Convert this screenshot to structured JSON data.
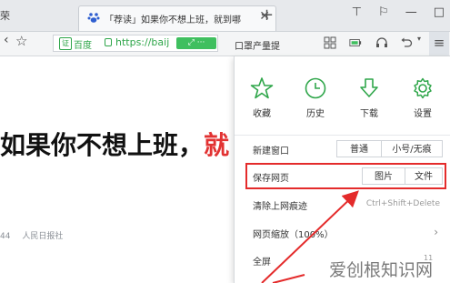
{
  "tabbar": {
    "prev_tab_label": "荣",
    "active_tab_title": "「荐读」如果你不想上班，就到哪",
    "close_glyph": "✕",
    "new_tab_glyph": "+"
  },
  "window_buttons": [
    "⊤",
    "⚐",
    "—",
    "□"
  ],
  "toolbar": {
    "back_glyph": "‹",
    "star_glyph": "☆",
    "badge_label": "证",
    "url_label": "百度",
    "url_text": "https://baij",
    "green_btn_label": "⤢ ···",
    "search_text": "口罩产量提",
    "menu_glyph": "≡"
  },
  "page": {
    "headline_main": "如果你不想上班，",
    "headline_red": "就",
    "meta_date": "44",
    "meta_source": "人民日报社"
  },
  "menu": {
    "quick_actions": [
      {
        "label": "收藏",
        "icon": "star-icon"
      },
      {
        "label": "历史",
        "icon": "clock-icon"
      },
      {
        "label": "下载",
        "icon": "download-icon"
      },
      {
        "label": "设置",
        "icon": "gear-icon"
      }
    ],
    "new_window": {
      "label": "新建窗口",
      "btn1": "普通",
      "btn2": "小号/无痕"
    },
    "save_page": {
      "label": "保存网页",
      "btn1": "图片",
      "btn2": "文件"
    },
    "clear_traces": {
      "label": "清除上网痕迹",
      "shortcut": "Ctrl+Shift+Delete"
    },
    "zoom": {
      "label": "网页缩放（100%）",
      "chevron": "›"
    },
    "fullscreen": {
      "label": "全屏",
      "shortcut": "11"
    }
  },
  "watermark": {
    "text": "爱创根知识网"
  },
  "colors": {
    "accent_green": "#2fa64a",
    "highlight_red": "#e42b2b"
  }
}
